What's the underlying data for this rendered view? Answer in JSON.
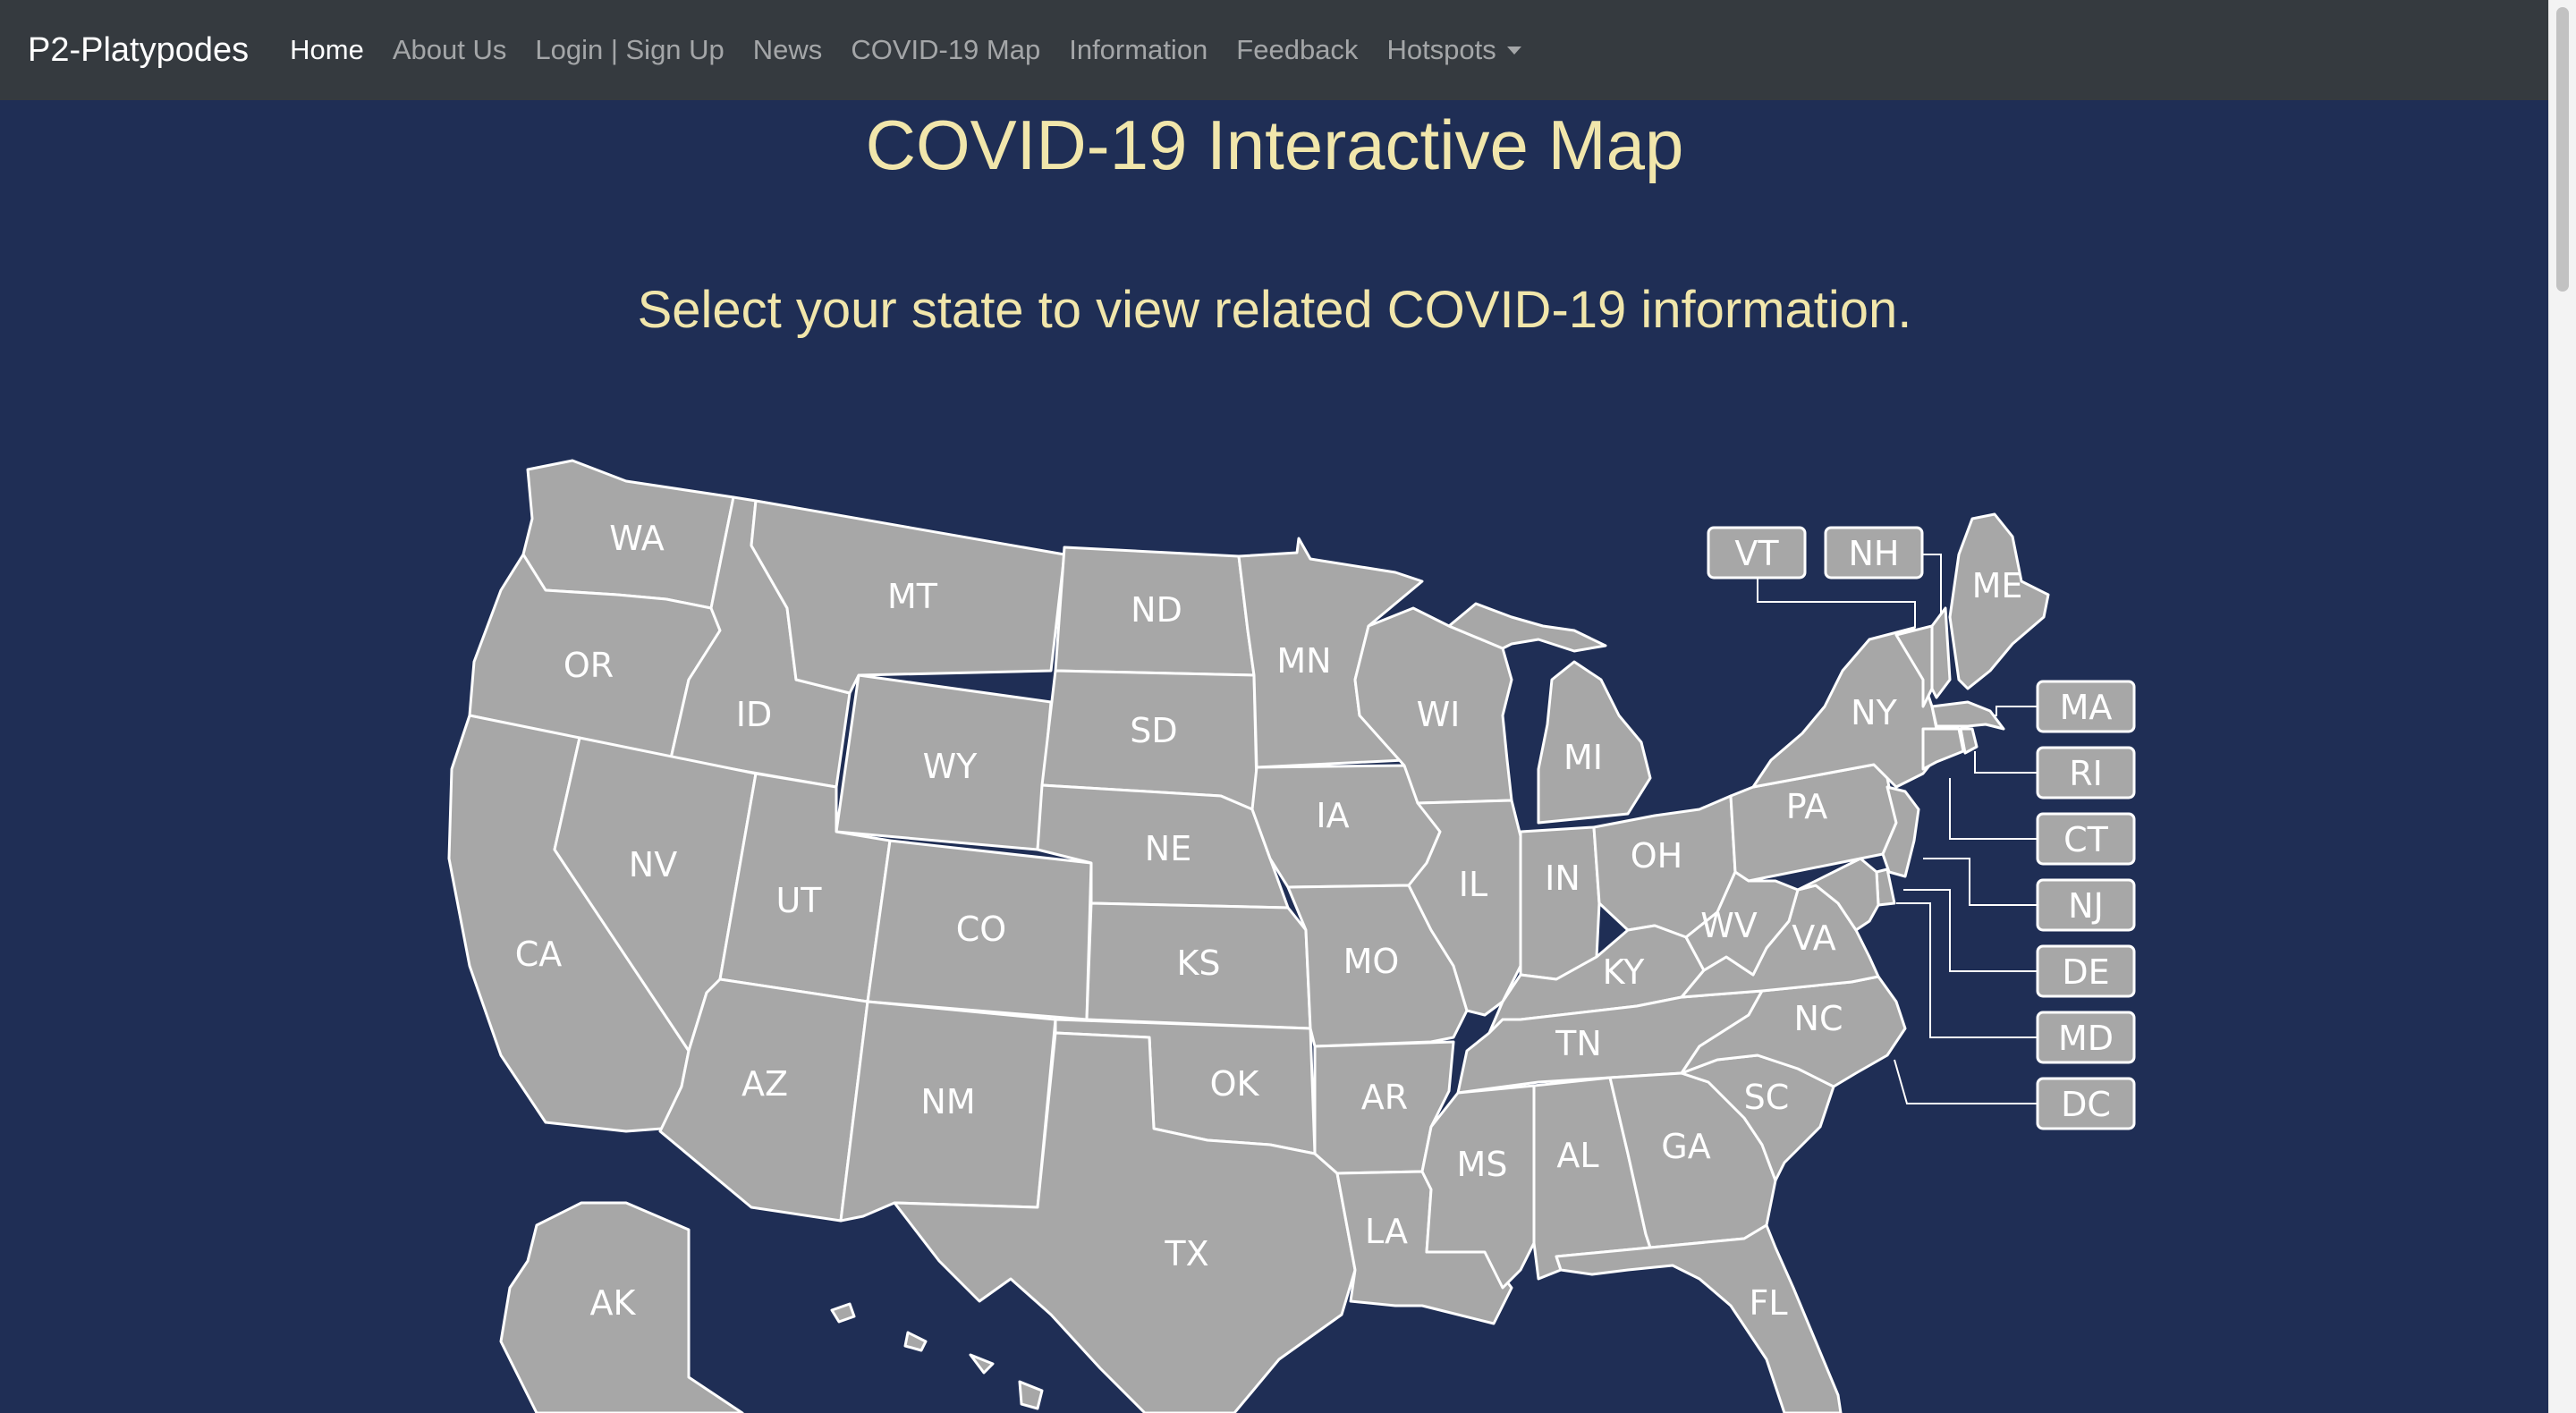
{
  "navbar": {
    "brand": "P2-Platypodes",
    "items": [
      {
        "label": "Home"
      },
      {
        "label": "About Us"
      },
      {
        "label": "Login | Sign Up"
      },
      {
        "label": "News"
      },
      {
        "label": "COVID-19 Map"
      },
      {
        "label": "Information"
      },
      {
        "label": "Feedback"
      },
      {
        "label": "Hotspots"
      }
    ]
  },
  "main": {
    "title": "COVID-19 Interactive Map",
    "subtitle": "Select your state to view related COVID-19 information."
  },
  "map": {
    "states": {
      "WA": "WA",
      "OR": "OR",
      "CA": "CA",
      "ID": "ID",
      "NV": "NV",
      "MT": "MT",
      "WY": "WY",
      "UT": "UT",
      "AZ": "AZ",
      "CO": "CO",
      "NM": "NM",
      "ND": "ND",
      "SD": "SD",
      "NE": "NE",
      "KS": "KS",
      "OK": "OK",
      "TX": "TX",
      "MN": "MN",
      "IA": "IA",
      "MO": "MO",
      "AR": "AR",
      "LA": "LA",
      "WI": "WI",
      "IL": "IL",
      "MS": "MS",
      "MI": "MI",
      "IN": "IN",
      "KY": "KY",
      "TN": "TN",
      "AL": "AL",
      "OH": "OH",
      "GA": "GA",
      "FL": "FL",
      "SC": "SC",
      "NC": "NC",
      "VA": "VA",
      "WV": "WV",
      "PA": "PA",
      "NY": "NY",
      "ME": "ME",
      "AK": "AK"
    },
    "callouts": {
      "VT": "VT",
      "NH": "NH",
      "MA": "MA",
      "RI": "RI",
      "CT": "CT",
      "NJ": "NJ",
      "DE": "DE",
      "MD": "MD",
      "DC": "DC"
    }
  },
  "colors": {
    "background": "#1f2e55",
    "navbar": "#353a3f",
    "heading": "#f1e6ab",
    "state_fill": "#a7a7a7",
    "state_stroke": "#ffffff"
  },
  "icons": {
    "hotspots_dropdown": "chevron-down-icon"
  }
}
